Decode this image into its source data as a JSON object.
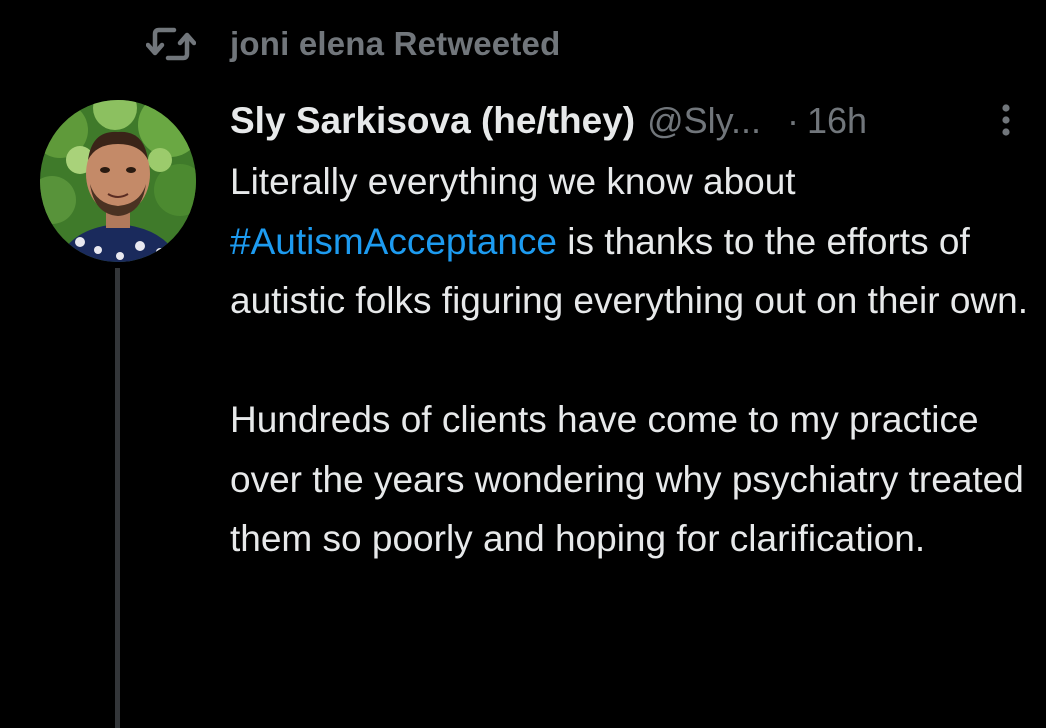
{
  "social_context": {
    "icon": "retweet-icon",
    "text": "joni elena Retweeted"
  },
  "author": {
    "avatar": "avatar",
    "display_name": "Sly Sarkisova (he/they)",
    "handle": "@Sly...",
    "separator": "·",
    "time": "16h"
  },
  "more_icon": "more-vertical-icon",
  "tweet": {
    "para1": {
      "before": "Literally everything we know about ",
      "hashtag": "#AutismAcceptance",
      "after": " is thanks to the efforts of autistic folks figuring everything out on their own."
    },
    "para2": "Hundreds of clients have come to my practice over the years wondering why psychiatry treated them so poorly and hoping for clarification."
  },
  "colors": {
    "background": "#000000",
    "text_primary": "#e7e9ea",
    "text_secondary": "#71767b",
    "link": "#1d9bf0",
    "thread_line": "#333639"
  }
}
